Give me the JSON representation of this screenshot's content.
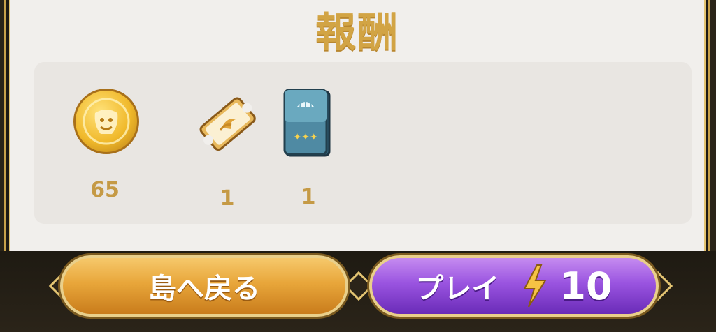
{
  "screen": {
    "title": "報酬"
  },
  "rewards": [
    {
      "icon": "gold-coin-icon",
      "count": "65"
    },
    {
      "icon": "ticket-icon",
      "count": "1"
    },
    {
      "icon": "card-deck-icon",
      "count": "1"
    }
  ],
  "buttons": {
    "back_label": "島へ戻る",
    "play_label": "プレイ",
    "play_cost": "10"
  },
  "colors": {
    "title_gold": "#d2a444",
    "count_gold": "#c59a45",
    "back_button": "#e8a63a",
    "play_button": "#9a54e0"
  }
}
